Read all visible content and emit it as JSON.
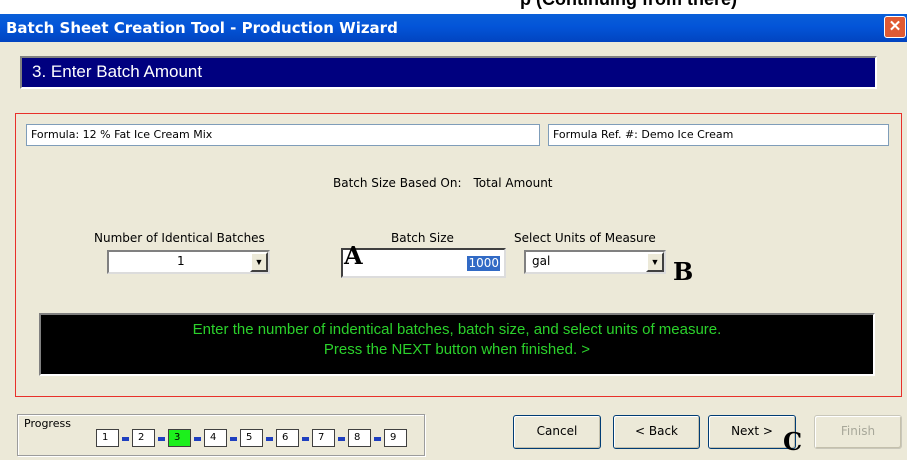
{
  "title_bar": {
    "title": "Batch Sheet Creation Tool - Production Wizard",
    "close_glyph": "✕",
    "cut_heading": "p (Continuing from there)"
  },
  "step_header": "3. Enter Batch Amount",
  "formula": {
    "name": "Formula: 12 % Fat Ice Cream Mix",
    "ref": "Formula Ref. #:  Demo Ice Cream"
  },
  "batch_size_based_on": {
    "label": "Batch Size Based On:",
    "value": "Total Amount"
  },
  "identical_batches": {
    "label": "Number of Identical Batches",
    "value": "1"
  },
  "batch_size": {
    "label": "Batch Size",
    "value": "1000"
  },
  "units": {
    "label": "Select Units of Measure",
    "value": "gal"
  },
  "callouts": {
    "a": "A",
    "b": "B",
    "c": "C"
  },
  "message": {
    "line1": "Enter the number of indentical batches, batch size, and select units of measure.",
    "line2": "Press the NEXT button when finished. >"
  },
  "progress": {
    "label": "Progress",
    "steps": [
      "1",
      "2",
      "3",
      "4",
      "5",
      "6",
      "7",
      "8",
      "9"
    ],
    "current": 3
  },
  "buttons": {
    "cancel": "Cancel",
    "back": "< Back",
    "next": "Next >",
    "finish": "Finish"
  },
  "colors": {
    "title_bar": "#0354d8",
    "step_header_bg": "#00007f",
    "message_text": "#2bd12b",
    "active_step": "#1cf01c",
    "frame": "#e8302a"
  }
}
